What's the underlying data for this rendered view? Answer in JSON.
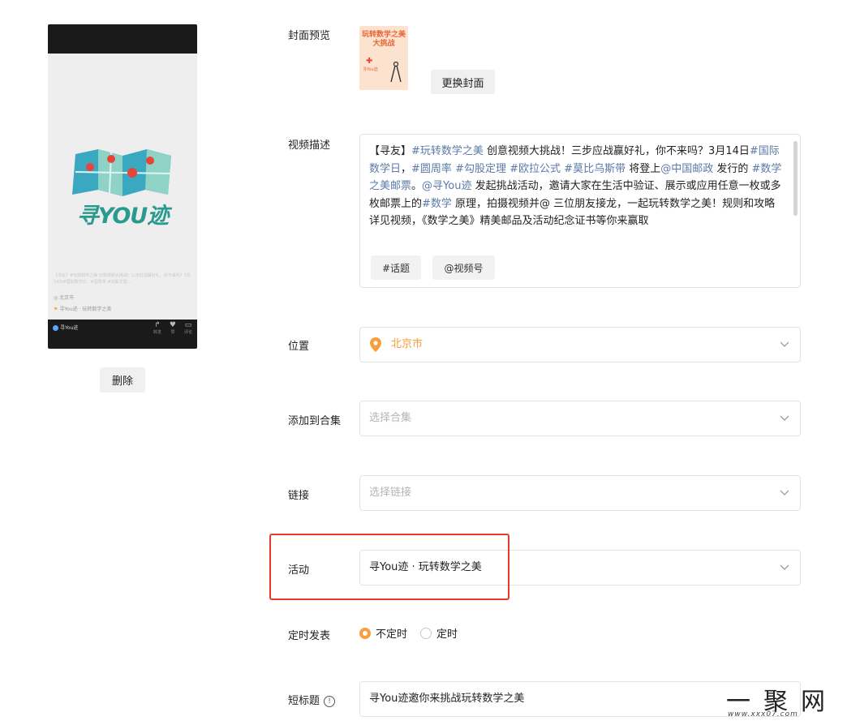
{
  "preview": {
    "logo_text": "寻YOU迹",
    "desc_blur": "【寻友】#玩转数学之美 创意视频大挑战！三步应战赢好礼，你不来吗？3月14日#国际数学日，#圆周率 #勾股定理 ...",
    "location": "北京市",
    "activity": "寻You迹 · 玩转数学之美",
    "channel": "寻You迹",
    "actions": [
      "转发",
      "赞",
      "评论"
    ],
    "delete_label": "删除"
  },
  "form": {
    "cover": {
      "label": "封面预览",
      "thumb_title": "玩转数学之美 大挑战",
      "thumb_small": "寻You迹",
      "change_label": "更换封面"
    },
    "description": {
      "label": "视频描述",
      "segments": [
        {
          "text": "【寻友】",
          "tag": false
        },
        {
          "text": "#玩转数学之美",
          "tag": true
        },
        {
          "text": " 创意视频大挑战！三步应战赢好礼，你不来吗？3月14日",
          "tag": false
        },
        {
          "text": "#国际数学日",
          "tag": true
        },
        {
          "text": "，",
          "tag": false
        },
        {
          "text": "#圆周率",
          "tag": true
        },
        {
          "text": " ",
          "tag": false
        },
        {
          "text": "#勾股定理",
          "tag": true
        },
        {
          "text": " ",
          "tag": false
        },
        {
          "text": "#欧拉公式",
          "tag": true
        },
        {
          "text": " ",
          "tag": false
        },
        {
          "text": "#莫比乌斯带",
          "tag": true
        },
        {
          "text": " 将登上",
          "tag": false
        },
        {
          "text": "@中国邮政",
          "tag": true
        },
        {
          "text": " 发行的 ",
          "tag": false
        },
        {
          "text": "#数学之美邮票",
          "tag": true
        },
        {
          "text": "。",
          "tag": false
        },
        {
          "text": "@寻You迹",
          "tag": true
        },
        {
          "text": " 发起挑战活动，邀请大家在生活中验证、展示或应用任意一枚或多枚邮票上的",
          "tag": false
        },
        {
          "text": "#数学",
          "tag": true
        },
        {
          "text": " 原理，拍摄视频并@ 三位朋友接龙，一起玩转数学之美！规则和攻略详见视频，《数学之美》精美邮品及活动纪念证书等你来赢取",
          "tag": false
        }
      ],
      "chip_topic": "#话题",
      "chip_mention": "@视频号"
    },
    "location": {
      "label": "位置",
      "value": "北京市"
    },
    "collection": {
      "label": "添加到合集",
      "placeholder": "选择合集"
    },
    "link": {
      "label": "链接",
      "placeholder": "选择链接"
    },
    "activity": {
      "label": "活动",
      "value": "寻You迹 · 玩转数学之美"
    },
    "schedule": {
      "label": "定时发表",
      "options": [
        "不定时",
        "定时"
      ],
      "selected": "不定时"
    },
    "short_title": {
      "label": "短标题",
      "value": "寻You迹邀你来挑战玩转数学之美"
    }
  },
  "watermark": {
    "mark": "一聚网",
    "url": "www.xxx07.com"
  },
  "colors": {
    "accent": "#fa9d3b",
    "tag": "#5b7aa8",
    "highlight": "#e8372c",
    "location": "#fa9d3b"
  }
}
